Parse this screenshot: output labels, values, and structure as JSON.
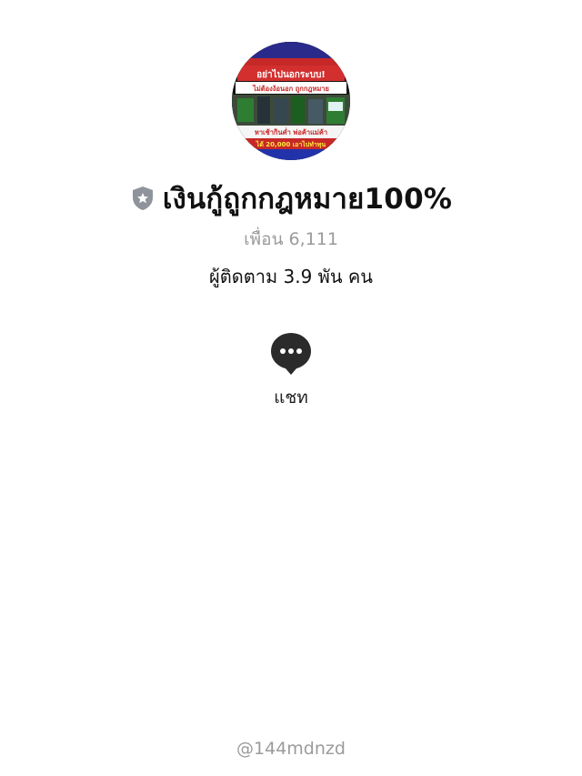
{
  "profile": {
    "avatar_image": "profile-photo",
    "avatar_lines": [
      "อย่าไปนอกระบบ!",
      "ไม่ต้องง้อนอก ถูกกฎหมาย",
      "หาเช้ากินค่ำ พ่อค้าแม่ค้า",
      "ได้ 20,000 เอาไปทำทุน"
    ],
    "badge_icon": "shield-star-icon",
    "name": "เงินกู้ถูกกฎหมาย100%",
    "friends": "เพื่อน 6,111",
    "followers": "ผู้ติดตาม 3.9 พัน คน",
    "handle": "@144mdnzd"
  },
  "actions": {
    "chat": {
      "icon": "chat-bubble-icon",
      "label": "แชท"
    }
  },
  "colors": {
    "title": "#111111",
    "muted": "#9b9b9b",
    "badge": "#8e939c",
    "chat_icon": "#2b2b2b"
  }
}
